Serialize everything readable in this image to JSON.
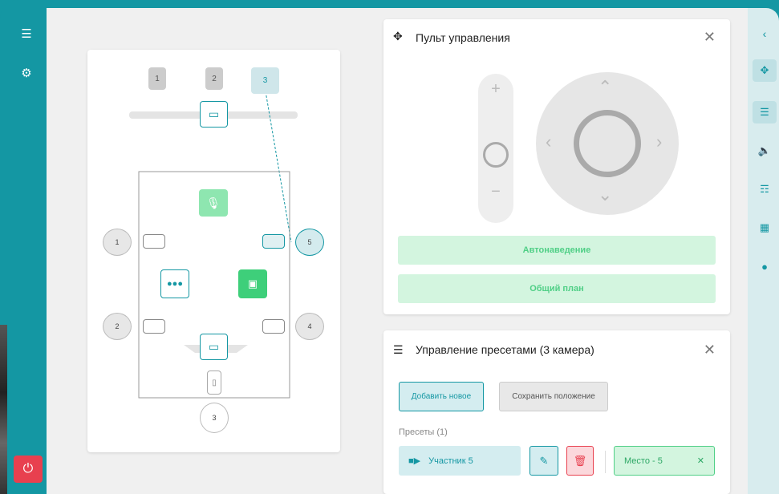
{
  "sidebar": {
    "menu_icon": "menu-icon",
    "settings_icon": "gear-icon",
    "power_icon": "power-icon"
  },
  "room": {
    "screens": [
      "1",
      "2",
      "3"
    ],
    "cameras": [
      "1",
      "5",
      "2",
      "4",
      "3"
    ]
  },
  "control": {
    "title": "Пульт управления",
    "zoom_plus": "+",
    "zoom_minus": "−",
    "auto_button": "Автонаведение",
    "wide_button": "Общий план"
  },
  "presets": {
    "title": "Управление пресетами (3 камера)",
    "add_button": "Добавить новое",
    "save_button": "Сохранить положение",
    "list_label": "Пресеты (1)",
    "items": [
      {
        "name": "Участник 5",
        "place": "Место - 5"
      }
    ]
  },
  "colors": {
    "accent": "#1497a3",
    "green": "#4fcf86",
    "red": "#e8404f"
  }
}
